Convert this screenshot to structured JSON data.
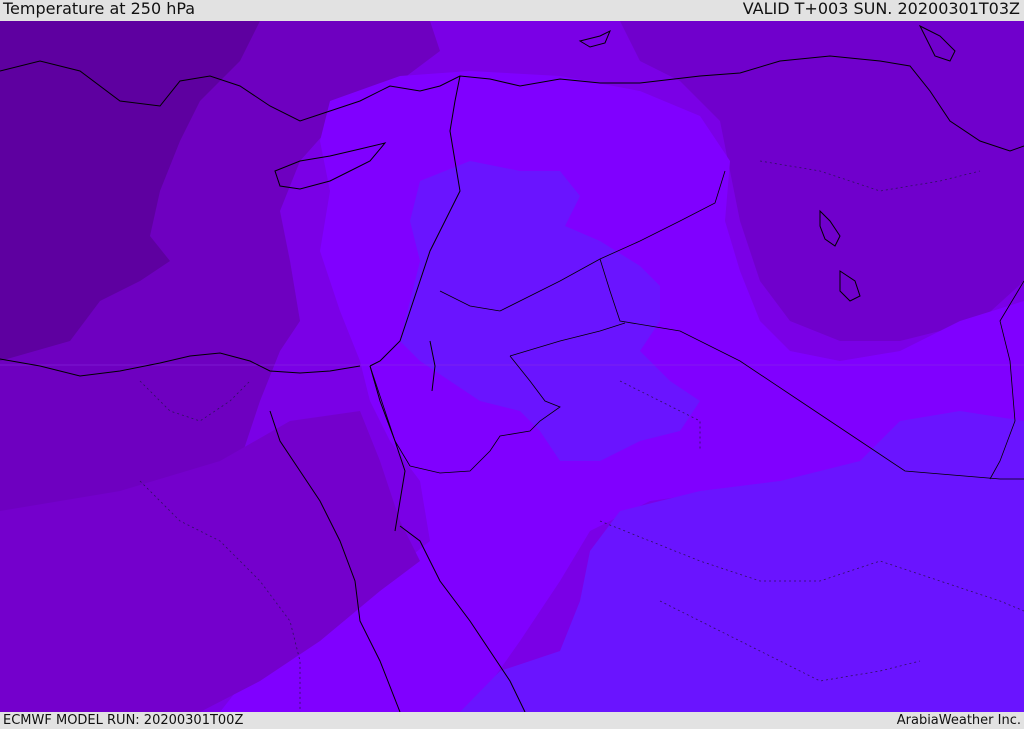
{
  "header": {
    "title": "Temperature at 250 hPa",
    "valid_time": "VALID T+003 SUN. 20200301T03Z"
  },
  "footer": {
    "model_run": "ECMWF MODEL RUN: 20200301T00Z",
    "credit": "ArabiaWeather Inc."
  },
  "colors": {
    "coldest_band": "#5e00a0",
    "cold_band": "#6a00b6",
    "mid_band": "#7400cc",
    "base_band": "#7a00e6",
    "warm_band": "#8000ff",
    "warmest_band": "#6a14ff",
    "coastline": "#000000"
  }
}
